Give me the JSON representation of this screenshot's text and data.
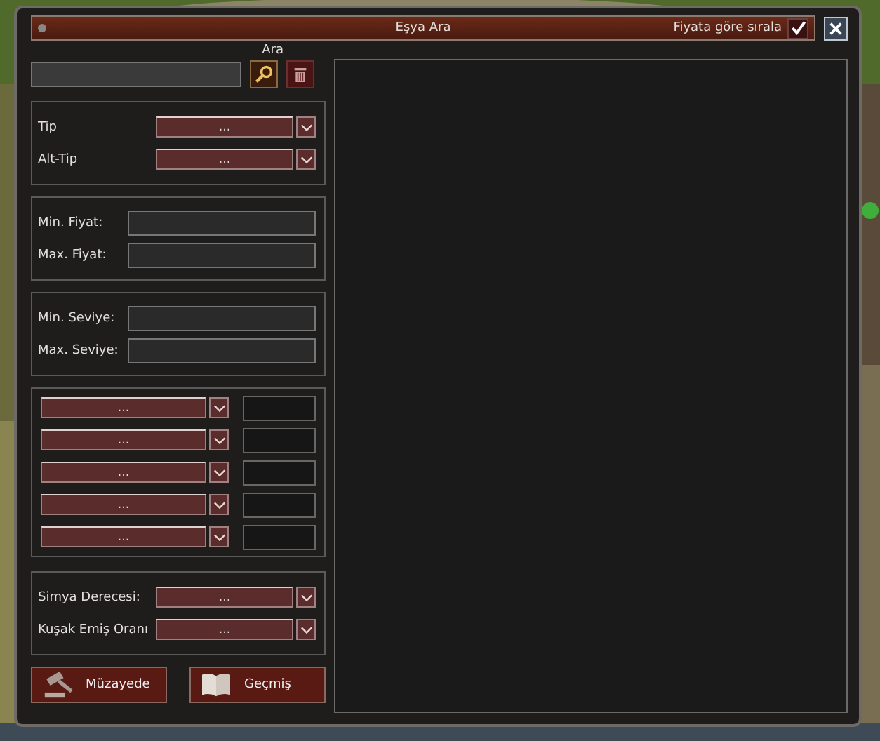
{
  "window": {
    "title": "Eşya Ara"
  },
  "sort": {
    "label": "Fiyata göre sırala",
    "checked": true
  },
  "search": {
    "label": "Ara"
  },
  "type_filters": [
    {
      "label": "Tip",
      "value": "..."
    },
    {
      "label": "Alt-Tip",
      "value": "..."
    }
  ],
  "price_fields": [
    {
      "label": "Min. Fiyat:"
    },
    {
      "label": "Max. Fiyat:"
    }
  ],
  "level_fields": [
    {
      "label": "Min. Seviye:"
    },
    {
      "label": "Max. Seviye:"
    }
  ],
  "bonus_rows": [
    {
      "value": "..."
    },
    {
      "value": "..."
    },
    {
      "value": "..."
    },
    {
      "value": "..."
    },
    {
      "value": "..."
    }
  ],
  "extra_filters": [
    {
      "label": "Simya Derecesi:",
      "value": "..."
    },
    {
      "label": "Kuşak Emiş Oranı",
      "value": "..."
    }
  ],
  "buttons": [
    {
      "label": "Müzayede",
      "kind": "gavel"
    },
    {
      "label": "Geçmiş",
      "kind": "book"
    }
  ]
}
